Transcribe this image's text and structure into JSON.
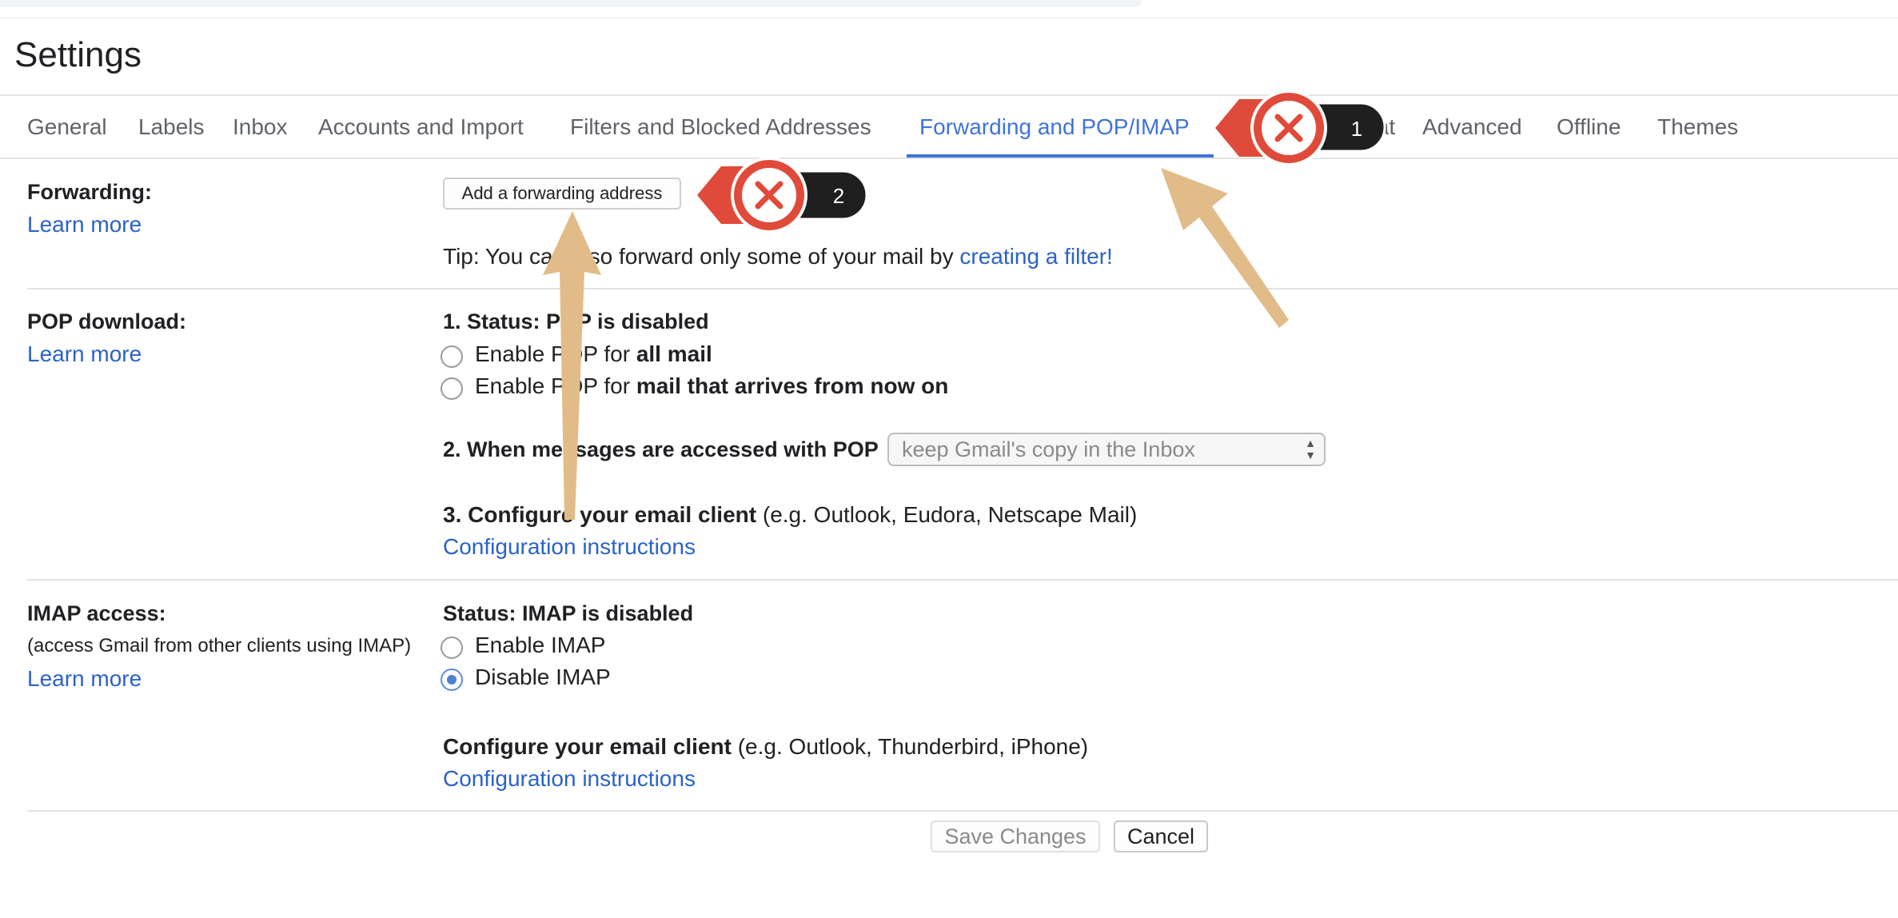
{
  "header": {
    "title": "Settings"
  },
  "tabs": [
    {
      "label": "General"
    },
    {
      "label": "Labels"
    },
    {
      "label": "Inbox"
    },
    {
      "label": "Accounts and Import"
    },
    {
      "label": "Filters and Blocked Addresses"
    },
    {
      "label": "Forwarding and POP/IMAP",
      "active": true
    },
    {
      "label": "Chat"
    },
    {
      "label": "Advanced"
    },
    {
      "label": "Offline"
    },
    {
      "label": "Themes"
    }
  ],
  "forwarding": {
    "label": "Forwarding:",
    "learn_more": "Learn more",
    "add_button": "Add a forwarding address",
    "tip_prefix": "Tip: You can also forward only some of your mail by ",
    "tip_link": "creating a filter!"
  },
  "pop": {
    "label": "POP download:",
    "learn_more": "Learn more",
    "status": "1. Status: POP is disabled",
    "option1_prefix": "Enable POP for ",
    "option1_bold": "all mail",
    "option2_prefix": "Enable POP for ",
    "option2_bold": "mail that arrives from now on",
    "when_accessed": "2. When messages are accessed with POP",
    "select_value": "keep Gmail's copy in the Inbox",
    "configure_bold": "3. Configure your email client",
    "configure_rest": " (e.g. Outlook, Eudora, Netscape Mail)",
    "config_link": "Configuration instructions"
  },
  "imap": {
    "label": "IMAP access:",
    "sublabel": "(access Gmail from other clients using IMAP)",
    "learn_more": "Learn more",
    "status": "Status: IMAP is disabled",
    "enable": "Enable IMAP",
    "disable": "Disable IMAP",
    "disable_selected": true,
    "configure_bold": "Configure your email client",
    "configure_rest": " (e.g. Outlook, Thunderbird, iPhone)",
    "config_link": "Configuration instructions"
  },
  "footer": {
    "save": "Save Changes",
    "cancel": "Cancel"
  },
  "annotations": {
    "badge1": "1",
    "badge2": "2",
    "marker_color": "#e04a3a",
    "badge_color": "#1f1f1f",
    "arrow_color": "#e2bc88"
  }
}
